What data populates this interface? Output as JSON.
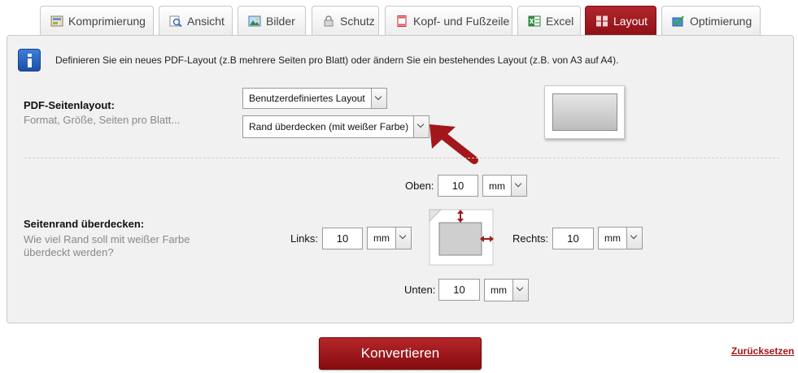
{
  "tabs": [
    {
      "label": "Komprimierung",
      "icon": "compress-icon"
    },
    {
      "label": "Ansicht",
      "icon": "view-icon"
    },
    {
      "label": "Bilder",
      "icon": "image-icon"
    },
    {
      "label": "Schutz",
      "icon": "lock-icon"
    },
    {
      "label": "Kopf- und Fußzeile",
      "icon": "header-footer-icon"
    },
    {
      "label": "Excel",
      "icon": "excel-icon"
    },
    {
      "label": "Layout",
      "icon": "layout-icon",
      "active": true
    },
    {
      "label": "Optimierung",
      "icon": "optimize-icon"
    }
  ],
  "info": {
    "icon": "info-icon",
    "text": "Definieren Sie ein neues PDF-Layout (z.B mehrere Seiten pro Blatt) oder ändern Sie ein bestehendes Layout (z.B. von A3 auf A4)."
  },
  "pdf_layout": {
    "title": "PDF-Seitenlayout:",
    "subtitle": "Format, Größe, Seiten pro Blatt...",
    "layout_select": "Benutzerdefiniertes Layout",
    "option_select": "Rand überdecken (mit weißer Farbe)"
  },
  "margin": {
    "title": "Seitenrand überdecken:",
    "subtitle": "Wie viel Rand soll mit weißer Farbe überdeckt werden?",
    "top": {
      "label": "Oben:",
      "value": "10",
      "unit": "mm"
    },
    "left": {
      "label": "Links:",
      "value": "10",
      "unit": "mm"
    },
    "right": {
      "label": "Rechts:",
      "value": "10",
      "unit": "mm"
    },
    "bottom": {
      "label": "Unten:",
      "value": "10",
      "unit": "mm"
    }
  },
  "actions": {
    "convert": "Konvertieren",
    "reset": "Zurücksetzen"
  },
  "colors": {
    "accent": "#9e1a1f",
    "arrow": "#a3161a"
  }
}
